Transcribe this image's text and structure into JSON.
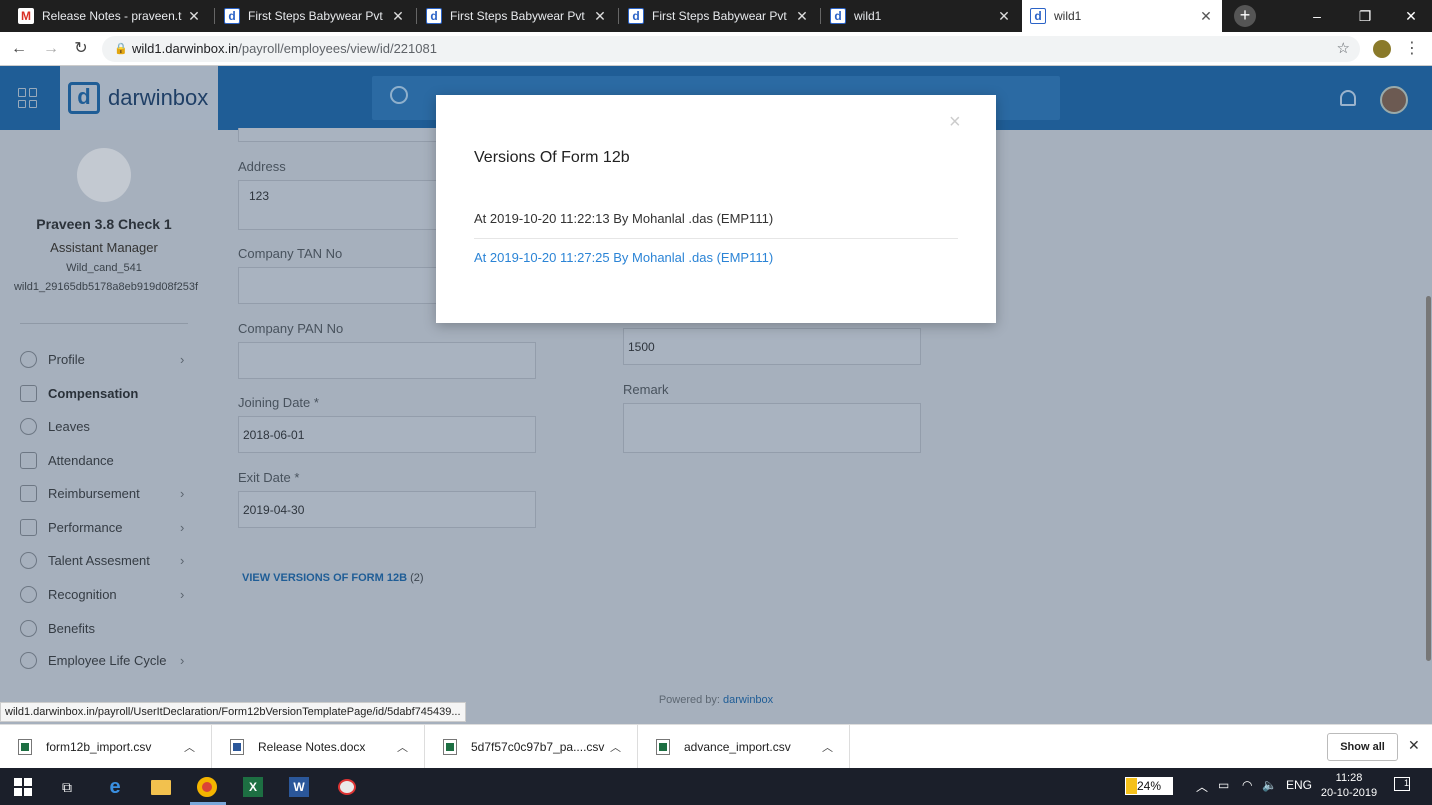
{
  "browser": {
    "tabs": [
      {
        "title": "Release Notes - praveen.t@d",
        "favicon": "gmail-icon"
      },
      {
        "title": "First Steps Babywear Pvt Ltd",
        "favicon": "darwinbox-icon"
      },
      {
        "title": "First Steps Babywear Pvt Ltd",
        "favicon": "darwinbox-icon"
      },
      {
        "title": "First Steps Babywear Pvt Ltd",
        "favicon": "darwinbox-icon"
      },
      {
        "title": "wild1",
        "favicon": "darwinbox-icon"
      },
      {
        "title": "wild1",
        "favicon": "darwinbox-icon"
      }
    ],
    "url_host": "wild1.darwinbox.in",
    "url_path": "/payroll/employees/view/id/221081",
    "status_url": "wild1.darwinbox.in/payroll/UserItDeclaration/Form12bVersionTemplatePage/id/5dabf745439..."
  },
  "app": {
    "logo_text": "darwinbox",
    "logo_mark": "d"
  },
  "employee": {
    "name": "Praveen 3.8 Check 1",
    "role": "Assistant Manager",
    "code": "Wild_cand_541",
    "id": "wild1_29165db5178a8eb919d08f253f"
  },
  "sidebar": {
    "items": [
      {
        "label": "Profile",
        "icon": "user-icon",
        "chevron": true
      },
      {
        "label": "Compensation",
        "icon": "coins-icon",
        "chevron": false,
        "active": true
      },
      {
        "label": "Leaves",
        "icon": "beach-icon",
        "chevron": false
      },
      {
        "label": "Attendance",
        "icon": "calendar-icon",
        "chevron": false
      },
      {
        "label": "Reimbursement",
        "icon": "wallet-icon",
        "chevron": true
      },
      {
        "label": "Performance",
        "icon": "chart-icon",
        "chevron": true
      },
      {
        "label": "Talent Assesment",
        "icon": "person-search-icon",
        "chevron": true
      },
      {
        "label": "Recognition",
        "icon": "badge-icon",
        "chevron": true
      },
      {
        "label": "Benefits",
        "icon": "hand-icon",
        "chevron": false
      },
      {
        "label": "Employee Life Cycle",
        "icon": "cycle-icon",
        "chevron": true
      }
    ]
  },
  "form": {
    "address_label": "Address",
    "address_value": "123",
    "tan_label": "Company TAN No",
    "tan_value": "",
    "pan_label": "Company PAN No",
    "pan_value": "",
    "joining_label": "Joining Date *",
    "joining_value": "2018-06-01",
    "exit_label": "Exit Date *",
    "exit_value": "2019-04-30",
    "amount_value": "1500",
    "remark_label": "Remark",
    "remark_value": "",
    "versions_link": "VIEW VERSIONS OF FORM 12B",
    "versions_count": "(2)"
  },
  "footer": {
    "powered_label": "Powered by:",
    "powered_brand": "darwinbox"
  },
  "modal": {
    "title": "Versions Of Form 12b",
    "close": "×",
    "versions": [
      "At 2019-10-20 11:22:13 By Mohanlal .das (EMP111)",
      "At 2019-10-20 11:27:25 By Mohanlal .das (EMP111)"
    ]
  },
  "downloads": {
    "items": [
      {
        "name": "form12b_import.csv",
        "type": "excel"
      },
      {
        "name": "Release Notes.docx",
        "type": "word"
      },
      {
        "name": "5d7f57c0c97b7_pa....csv",
        "type": "excel"
      },
      {
        "name": "advance_import.csv",
        "type": "excel"
      }
    ],
    "show_all": "Show all"
  },
  "taskbar": {
    "battery": "24%",
    "battery_level": 0.24,
    "language": "ENG",
    "time": "11:28",
    "date": "20-10-2019",
    "notifications": "1"
  },
  "colors": {
    "brand_blue": "#1f5d96",
    "link_blue": "#2b84d6"
  }
}
